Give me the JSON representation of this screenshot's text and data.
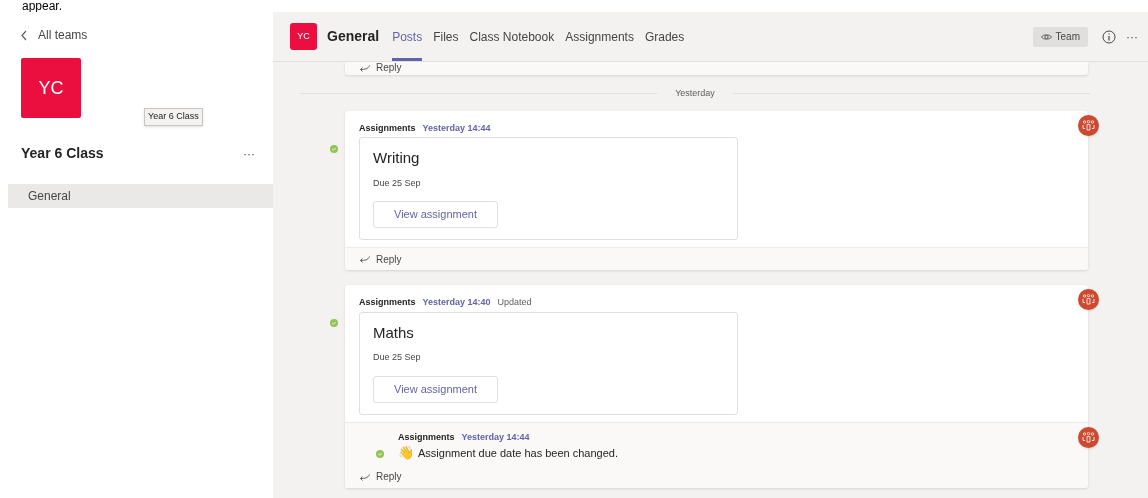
{
  "document_text": "appear.",
  "sidebar": {
    "back_link": "All teams",
    "team_initials": "YC",
    "tooltip": "Year 6 Class",
    "team_name": "Year 6 Class",
    "more": "···",
    "channels": [
      {
        "label": "General",
        "selected": true
      }
    ]
  },
  "header": {
    "initials": "YC",
    "channel": "General",
    "tabs": [
      {
        "label": "Posts",
        "selected": true
      },
      {
        "label": "Files",
        "selected": false
      },
      {
        "label": "Class Notebook",
        "selected": false
      },
      {
        "label": "Assignments",
        "selected": false
      },
      {
        "label": "Grades",
        "selected": false
      }
    ],
    "team_button": "Team",
    "more": "···"
  },
  "previous_post": {
    "reply": "Reply"
  },
  "date_divider": "Yesterday",
  "posts": [
    {
      "author": "Assignments",
      "time": "Yesterday 14:44",
      "title": "Writing",
      "due": "Due 25 Sep",
      "button": "View assignment",
      "reply": "Reply"
    },
    {
      "author": "Assignments",
      "time": "Yesterday 14:40",
      "updated": "Updated",
      "title": "Maths",
      "due": "Due 25 Sep",
      "button": "View assignment",
      "replies": [
        {
          "author": "Assignments",
          "time": "Yesterday 14:44",
          "emoji": "👋",
          "text": "Assignment due date has been changed."
        }
      ],
      "reply": "Reply"
    }
  ]
}
